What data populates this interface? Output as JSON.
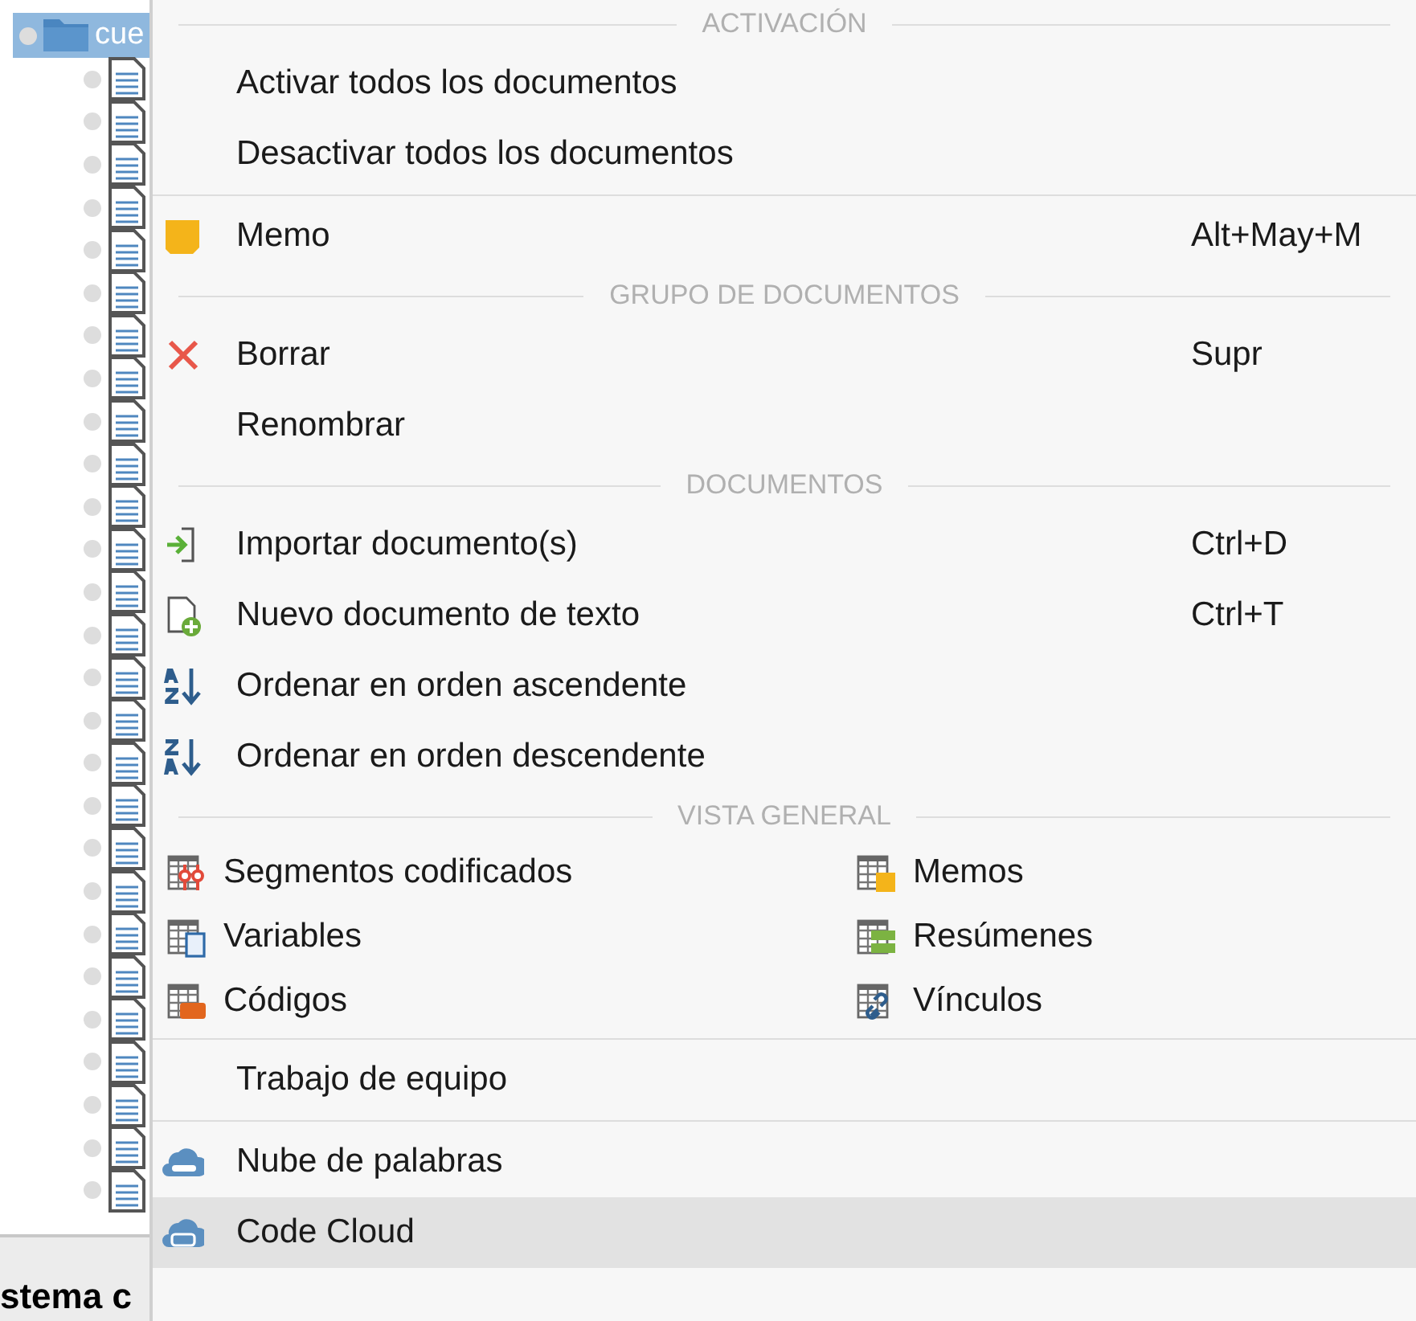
{
  "tree": {
    "folder": {
      "label": "cue",
      "selected": true
    },
    "documents": [
      {
        "kind": "text"
      },
      {
        "kind": "text"
      },
      {
        "kind": "text"
      },
      {
        "kind": "text"
      },
      {
        "kind": "text"
      },
      {
        "kind": "text"
      },
      {
        "kind": "text"
      },
      {
        "kind": "text"
      },
      {
        "kind": "text"
      },
      {
        "kind": "text"
      },
      {
        "kind": "text"
      },
      {
        "kind": "text"
      },
      {
        "kind": "text"
      },
      {
        "kind": "text"
      },
      {
        "kind": "text"
      },
      {
        "kind": "text"
      },
      {
        "kind": "text"
      },
      {
        "kind": "text"
      },
      {
        "kind": "text"
      },
      {
        "kind": "text"
      },
      {
        "kind": "text"
      },
      {
        "kind": "text"
      },
      {
        "kind": "text"
      },
      {
        "kind": "text"
      },
      {
        "kind": "text"
      },
      {
        "kind": "text"
      },
      {
        "kind": "text"
      }
    ]
  },
  "status_bar": {
    "text": "stema c"
  },
  "menu": {
    "sections": [
      {
        "kind": "list",
        "header": "ACTIVACIÓN",
        "items": [
          {
            "label": "Activar todos los documentos",
            "selected": false
          },
          {
            "label": "Desactivar todos los documentos",
            "selected": false
          }
        ]
      },
      {
        "kind": "list",
        "items": [
          {
            "label": "Memo",
            "shortcut": "Alt+May+M",
            "kind": "memo",
            "selected": false
          }
        ]
      },
      {
        "kind": "list",
        "header": "GRUPO DE DOCUMENTOS",
        "items": [
          {
            "label": "Borrar",
            "shortcut": "Supr",
            "kind": "delete",
            "selected": false
          },
          {
            "label": "Renombrar",
            "selected": false
          }
        ]
      },
      {
        "kind": "list",
        "header": "DOCUMENTOS",
        "items": [
          {
            "label": "Importar documento(s)",
            "shortcut": "Ctrl+D",
            "kind": "import",
            "selected": false
          },
          {
            "label": "Nuevo documento de texto",
            "shortcut": "Ctrl+T",
            "kind": "new-doc",
            "selected": false
          },
          {
            "label": "Ordenar en orden ascendente",
            "kind": "sort-asc",
            "selected": false
          },
          {
            "label": "Ordenar en orden descendente",
            "kind": "sort-desc",
            "selected": false
          }
        ]
      },
      {
        "kind": "grid",
        "header": "VISTA GENERAL",
        "items": [
          {
            "label": "Segmentos codificados",
            "kind": "segments",
            "selected": false
          },
          {
            "label": "Memos",
            "kind": "memos",
            "selected": false
          },
          {
            "label": "Variables",
            "kind": "variables",
            "selected": false
          },
          {
            "label": "Resúmenes",
            "kind": "summaries",
            "selected": false
          },
          {
            "label": "Códigos",
            "kind": "codes",
            "selected": false
          },
          {
            "label": "Vínculos",
            "kind": "links",
            "selected": false
          }
        ]
      },
      {
        "kind": "list",
        "items": [
          {
            "label": "Trabajo de equipo",
            "selected": false
          }
        ]
      },
      {
        "kind": "list",
        "items": [
          {
            "label": "Nube de palabras",
            "kind": "word-cloud",
            "selected": false
          },
          {
            "label": "Code Cloud",
            "kind": "code-cloud",
            "selected": true
          }
        ]
      }
    ]
  }
}
